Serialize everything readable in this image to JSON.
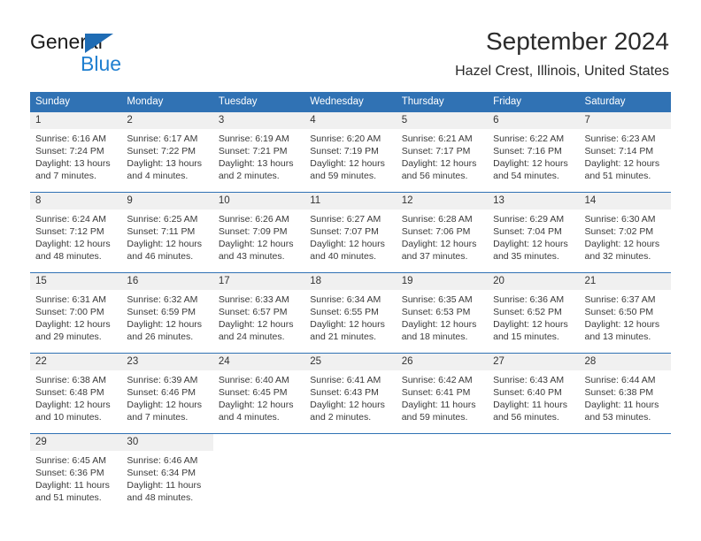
{
  "brand": {
    "name_part1": "General",
    "name_part2": "Blue",
    "triangle_color": "#1f6cb4",
    "blue_color": "#1f7fd0"
  },
  "header": {
    "title": "September 2024",
    "subtitle": "Hazel Crest, Illinois, United States"
  },
  "theme": {
    "header_bg": "#3072b4",
    "day_band_bg": "#f0f0f0",
    "row_divider": "#3072b4",
    "text": "#333333"
  },
  "weekdays": [
    "Sunday",
    "Monday",
    "Tuesday",
    "Wednesday",
    "Thursday",
    "Friday",
    "Saturday"
  ],
  "weeks": [
    [
      {
        "day": "1",
        "sunrise": "Sunrise: 6:16 AM",
        "sunset": "Sunset: 7:24 PM",
        "daylight1": "Daylight: 13 hours",
        "daylight2": "and 7 minutes."
      },
      {
        "day": "2",
        "sunrise": "Sunrise: 6:17 AM",
        "sunset": "Sunset: 7:22 PM",
        "daylight1": "Daylight: 13 hours",
        "daylight2": "and 4 minutes."
      },
      {
        "day": "3",
        "sunrise": "Sunrise: 6:19 AM",
        "sunset": "Sunset: 7:21 PM",
        "daylight1": "Daylight: 13 hours",
        "daylight2": "and 2 minutes."
      },
      {
        "day": "4",
        "sunrise": "Sunrise: 6:20 AM",
        "sunset": "Sunset: 7:19 PM",
        "daylight1": "Daylight: 12 hours",
        "daylight2": "and 59 minutes."
      },
      {
        "day": "5",
        "sunrise": "Sunrise: 6:21 AM",
        "sunset": "Sunset: 7:17 PM",
        "daylight1": "Daylight: 12 hours",
        "daylight2": "and 56 minutes."
      },
      {
        "day": "6",
        "sunrise": "Sunrise: 6:22 AM",
        "sunset": "Sunset: 7:16 PM",
        "daylight1": "Daylight: 12 hours",
        "daylight2": "and 54 minutes."
      },
      {
        "day": "7",
        "sunrise": "Sunrise: 6:23 AM",
        "sunset": "Sunset: 7:14 PM",
        "daylight1": "Daylight: 12 hours",
        "daylight2": "and 51 minutes."
      }
    ],
    [
      {
        "day": "8",
        "sunrise": "Sunrise: 6:24 AM",
        "sunset": "Sunset: 7:12 PM",
        "daylight1": "Daylight: 12 hours",
        "daylight2": "and 48 minutes."
      },
      {
        "day": "9",
        "sunrise": "Sunrise: 6:25 AM",
        "sunset": "Sunset: 7:11 PM",
        "daylight1": "Daylight: 12 hours",
        "daylight2": "and 46 minutes."
      },
      {
        "day": "10",
        "sunrise": "Sunrise: 6:26 AM",
        "sunset": "Sunset: 7:09 PM",
        "daylight1": "Daylight: 12 hours",
        "daylight2": "and 43 minutes."
      },
      {
        "day": "11",
        "sunrise": "Sunrise: 6:27 AM",
        "sunset": "Sunset: 7:07 PM",
        "daylight1": "Daylight: 12 hours",
        "daylight2": "and 40 minutes."
      },
      {
        "day": "12",
        "sunrise": "Sunrise: 6:28 AM",
        "sunset": "Sunset: 7:06 PM",
        "daylight1": "Daylight: 12 hours",
        "daylight2": "and 37 minutes."
      },
      {
        "day": "13",
        "sunrise": "Sunrise: 6:29 AM",
        "sunset": "Sunset: 7:04 PM",
        "daylight1": "Daylight: 12 hours",
        "daylight2": "and 35 minutes."
      },
      {
        "day": "14",
        "sunrise": "Sunrise: 6:30 AM",
        "sunset": "Sunset: 7:02 PM",
        "daylight1": "Daylight: 12 hours",
        "daylight2": "and 32 minutes."
      }
    ],
    [
      {
        "day": "15",
        "sunrise": "Sunrise: 6:31 AM",
        "sunset": "Sunset: 7:00 PM",
        "daylight1": "Daylight: 12 hours",
        "daylight2": "and 29 minutes."
      },
      {
        "day": "16",
        "sunrise": "Sunrise: 6:32 AM",
        "sunset": "Sunset: 6:59 PM",
        "daylight1": "Daylight: 12 hours",
        "daylight2": "and 26 minutes."
      },
      {
        "day": "17",
        "sunrise": "Sunrise: 6:33 AM",
        "sunset": "Sunset: 6:57 PM",
        "daylight1": "Daylight: 12 hours",
        "daylight2": "and 24 minutes."
      },
      {
        "day": "18",
        "sunrise": "Sunrise: 6:34 AM",
        "sunset": "Sunset: 6:55 PM",
        "daylight1": "Daylight: 12 hours",
        "daylight2": "and 21 minutes."
      },
      {
        "day": "19",
        "sunrise": "Sunrise: 6:35 AM",
        "sunset": "Sunset: 6:53 PM",
        "daylight1": "Daylight: 12 hours",
        "daylight2": "and 18 minutes."
      },
      {
        "day": "20",
        "sunrise": "Sunrise: 6:36 AM",
        "sunset": "Sunset: 6:52 PM",
        "daylight1": "Daylight: 12 hours",
        "daylight2": "and 15 minutes."
      },
      {
        "day": "21",
        "sunrise": "Sunrise: 6:37 AM",
        "sunset": "Sunset: 6:50 PM",
        "daylight1": "Daylight: 12 hours",
        "daylight2": "and 13 minutes."
      }
    ],
    [
      {
        "day": "22",
        "sunrise": "Sunrise: 6:38 AM",
        "sunset": "Sunset: 6:48 PM",
        "daylight1": "Daylight: 12 hours",
        "daylight2": "and 10 minutes."
      },
      {
        "day": "23",
        "sunrise": "Sunrise: 6:39 AM",
        "sunset": "Sunset: 6:46 PM",
        "daylight1": "Daylight: 12 hours",
        "daylight2": "and 7 minutes."
      },
      {
        "day": "24",
        "sunrise": "Sunrise: 6:40 AM",
        "sunset": "Sunset: 6:45 PM",
        "daylight1": "Daylight: 12 hours",
        "daylight2": "and 4 minutes."
      },
      {
        "day": "25",
        "sunrise": "Sunrise: 6:41 AM",
        "sunset": "Sunset: 6:43 PM",
        "daylight1": "Daylight: 12 hours",
        "daylight2": "and 2 minutes."
      },
      {
        "day": "26",
        "sunrise": "Sunrise: 6:42 AM",
        "sunset": "Sunset: 6:41 PM",
        "daylight1": "Daylight: 11 hours",
        "daylight2": "and 59 minutes."
      },
      {
        "day": "27",
        "sunrise": "Sunrise: 6:43 AM",
        "sunset": "Sunset: 6:40 PM",
        "daylight1": "Daylight: 11 hours",
        "daylight2": "and 56 minutes."
      },
      {
        "day": "28",
        "sunrise": "Sunrise: 6:44 AM",
        "sunset": "Sunset: 6:38 PM",
        "daylight1": "Daylight: 11 hours",
        "daylight2": "and 53 minutes."
      }
    ],
    [
      {
        "day": "29",
        "sunrise": "Sunrise: 6:45 AM",
        "sunset": "Sunset: 6:36 PM",
        "daylight1": "Daylight: 11 hours",
        "daylight2": "and 51 minutes."
      },
      {
        "day": "30",
        "sunrise": "Sunrise: 6:46 AM",
        "sunset": "Sunset: 6:34 PM",
        "daylight1": "Daylight: 11 hours",
        "daylight2": "and 48 minutes."
      },
      {
        "day": "",
        "sunrise": "",
        "sunset": "",
        "daylight1": "",
        "daylight2": ""
      },
      {
        "day": "",
        "sunrise": "",
        "sunset": "",
        "daylight1": "",
        "daylight2": ""
      },
      {
        "day": "",
        "sunrise": "",
        "sunset": "",
        "daylight1": "",
        "daylight2": ""
      },
      {
        "day": "",
        "sunrise": "",
        "sunset": "",
        "daylight1": "",
        "daylight2": ""
      },
      {
        "day": "",
        "sunrise": "",
        "sunset": "",
        "daylight1": "",
        "daylight2": ""
      }
    ]
  ]
}
